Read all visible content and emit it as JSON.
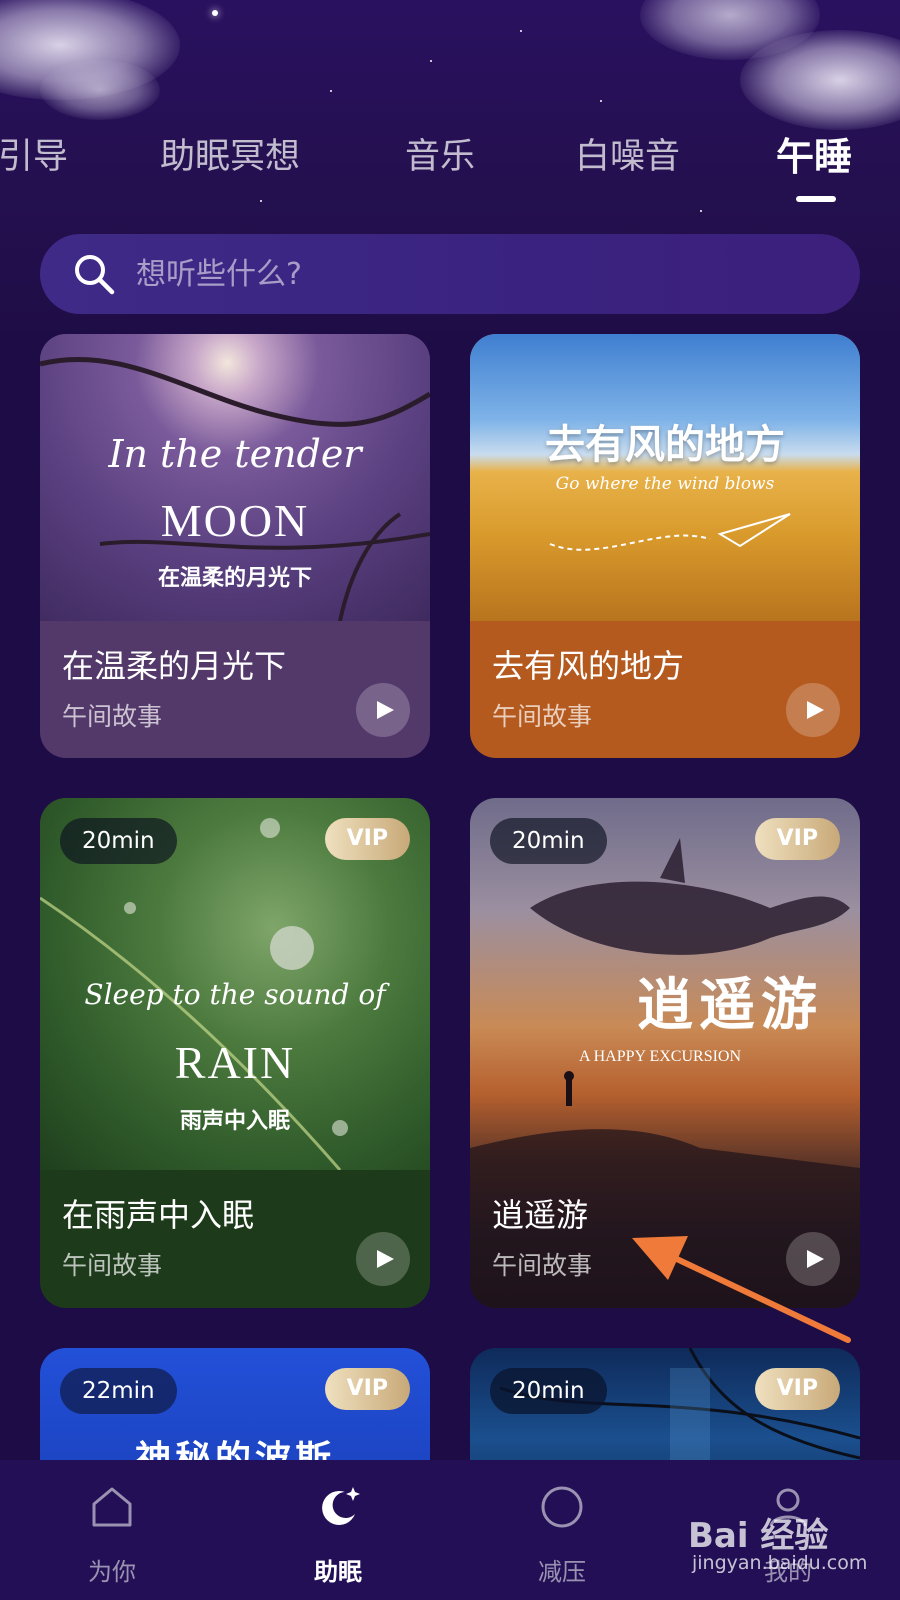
{
  "tabs": [
    {
      "label": "引导"
    },
    {
      "label": "助眠冥想"
    },
    {
      "label": "音乐"
    },
    {
      "label": "白噪音"
    },
    {
      "label": "午睡"
    }
  ],
  "search": {
    "placeholder": "想听些什么?"
  },
  "cards": [
    {
      "title": "在温柔的月光下",
      "subtitle": "午间故事",
      "art_script": "In the tender",
      "art_main": "MOON",
      "art_cn": "在温柔的月光下"
    },
    {
      "title": "去有风的地方",
      "subtitle": "午间故事",
      "art_cn": "去有风的地方",
      "art_script": "Go where the wind blows"
    },
    {
      "title": "在雨声中入眠",
      "subtitle": "午间故事",
      "duration": "20min",
      "badge": "VIP",
      "art_script": "Sleep to the sound of",
      "art_main": "RAIN",
      "art_cn": "雨声中入眠"
    },
    {
      "title": "逍遥游",
      "subtitle": "午间故事",
      "duration": "20min",
      "badge": "VIP",
      "art_cn": "逍遥游",
      "art_en": "A HAPPY EXCURSION"
    },
    {
      "duration": "22min",
      "badge": "VIP",
      "art_cn": "神秘的波斯"
    },
    {
      "duration": "20min",
      "badge": "VIP"
    }
  ],
  "bottom_nav": [
    {
      "label": "为你",
      "icon": "home-icon"
    },
    {
      "label": "助眠",
      "icon": "moon-icon",
      "active": true
    },
    {
      "label": "减压",
      "icon": "circle-icon"
    },
    {
      "label": "我的",
      "icon": "profile-icon"
    }
  ],
  "watermark": {
    "brand": "Bai 经验",
    "url": "jingyan.baidu.com"
  },
  "colors": {
    "background": "#1e0c47",
    "accent_arrow": "#f07a3a",
    "vip_gold": "#d8bf90"
  }
}
